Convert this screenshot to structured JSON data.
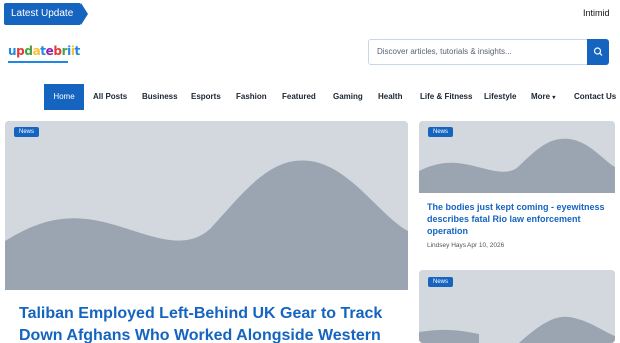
{
  "ticker": {
    "label": "Latest Update",
    "headline": "Intimid"
  },
  "header": {
    "logo_letters": [
      "u",
      "p",
      "d",
      "a",
      "t",
      "e",
      "b",
      "r",
      "i",
      "i",
      "t"
    ],
    "logo_colors": [
      "#1e88e5",
      "#e53935",
      "#43a047",
      "#fbc02d",
      "#1e88e5",
      "#8e24aa",
      "#e53935",
      "#43a047",
      "#1e88e5",
      "#fbc02d",
      "#1e88e5"
    ],
    "search_placeholder": "Discover articles, tutorials & insights..."
  },
  "nav": {
    "items": [
      "Home",
      "All Posts",
      "Business",
      "Esports",
      "Fashion",
      "Featured",
      "Gaming",
      "Health",
      "Life & Fitness",
      "Lifestyle",
      "More",
      "Contact Us"
    ],
    "active": "Home"
  },
  "main_post": {
    "category": "News",
    "title": "Taliban Employed Left-Behind UK Gear to Track Down Afghans Who Worked Alongside Western"
  },
  "side_posts": [
    {
      "category": "News",
      "title": "The bodies just kept coming - eyewitness describes fatal Rio law enforcement operation",
      "author": "Lindsey Hays",
      "date": "Apr 10, 2026"
    },
    {
      "category": "News"
    }
  ],
  "colors": {
    "accent": "#1565c0",
    "placeholder_bg": "#d3d8de",
    "placeholder_shape": "#9ba5b1"
  }
}
